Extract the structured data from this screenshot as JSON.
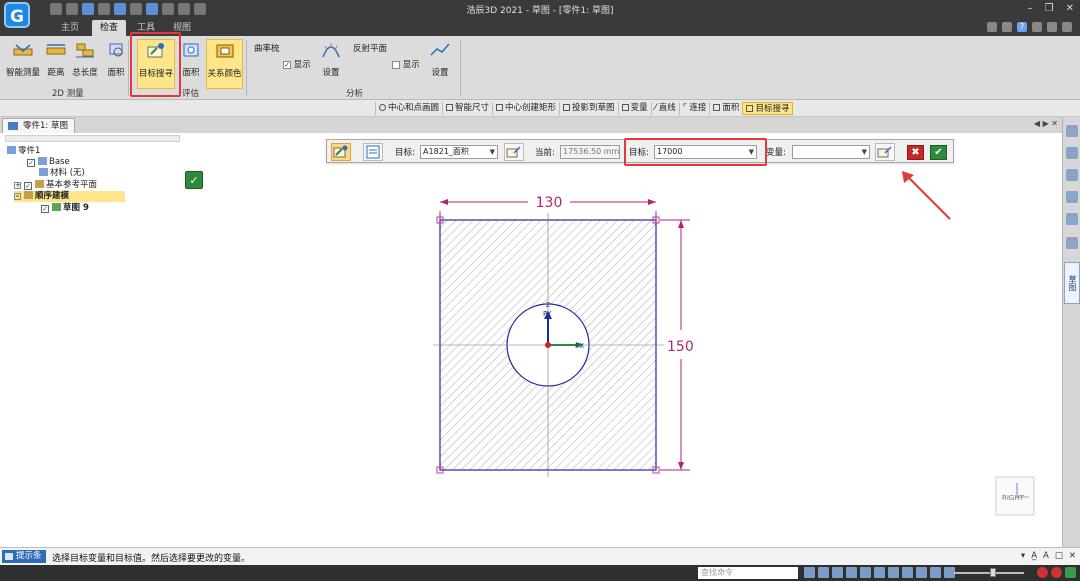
{
  "window": {
    "title": "浩辰3D 2021 - 草图 - [零件1: 草图]",
    "logo": "G"
  },
  "ribbon_tabs": [
    "主页",
    "检查",
    "工具",
    "视图"
  ],
  "ribbon": {
    "measure_2d": {
      "items": [
        "智能测量",
        "距离",
        "总长度",
        "面积"
      ],
      "group_label": "2D 测量"
    },
    "evaluate": {
      "items": [
        "目标搜寻",
        "面积",
        "关系颜色"
      ],
      "group_label": "评估"
    },
    "analysis": {
      "curvature_label": "曲率梳",
      "curvature_show": "显示",
      "curvature_settings": "设置",
      "reflective_label": "反射平面",
      "reflective_show": "显示",
      "reflective_settings": "设置",
      "group_label": "分析"
    }
  },
  "command_bar": [
    "中心和点画圆",
    "智能尺寸",
    "中心创建矩形",
    "投影到草图",
    "变量",
    "直线",
    "连接",
    "面积",
    "目标搜寻"
  ],
  "document_tab": "零件1: 草图",
  "pathfinder": {
    "root": "零件1",
    "base": "Base",
    "material": "材料 (无)",
    "ref_planes": "基本参考平面",
    "ordered": "顺序建模",
    "sketch": "草图 9"
  },
  "goal_seek": {
    "target_label": "目标:",
    "target_value": "A1821_面积",
    "current_label": "当前:",
    "current_value": "17536.50 mm^2",
    "goal_label": "目标:",
    "goal_value": "17000",
    "variable_label": "变量:",
    "variable_value": ""
  },
  "drawing": {
    "dim_width": "130",
    "dim_height": "150",
    "axis_y_label": "PY",
    "axis_x_label": "PX",
    "axis_z_label": "Z",
    "view_cube_label": "RIGHT"
  },
  "right_sidebar_tab": "草图",
  "prompt": {
    "tag": "提示条",
    "text": "选择目标变量和目标值。然后选择要更改的变量。"
  },
  "status": {
    "search_placeholder": "查找命令"
  },
  "colors": {
    "highlight": "#fde68a",
    "callout_red": "#e03a3a",
    "dimension": "#b0237a",
    "geometry": "#1f2b9c"
  }
}
